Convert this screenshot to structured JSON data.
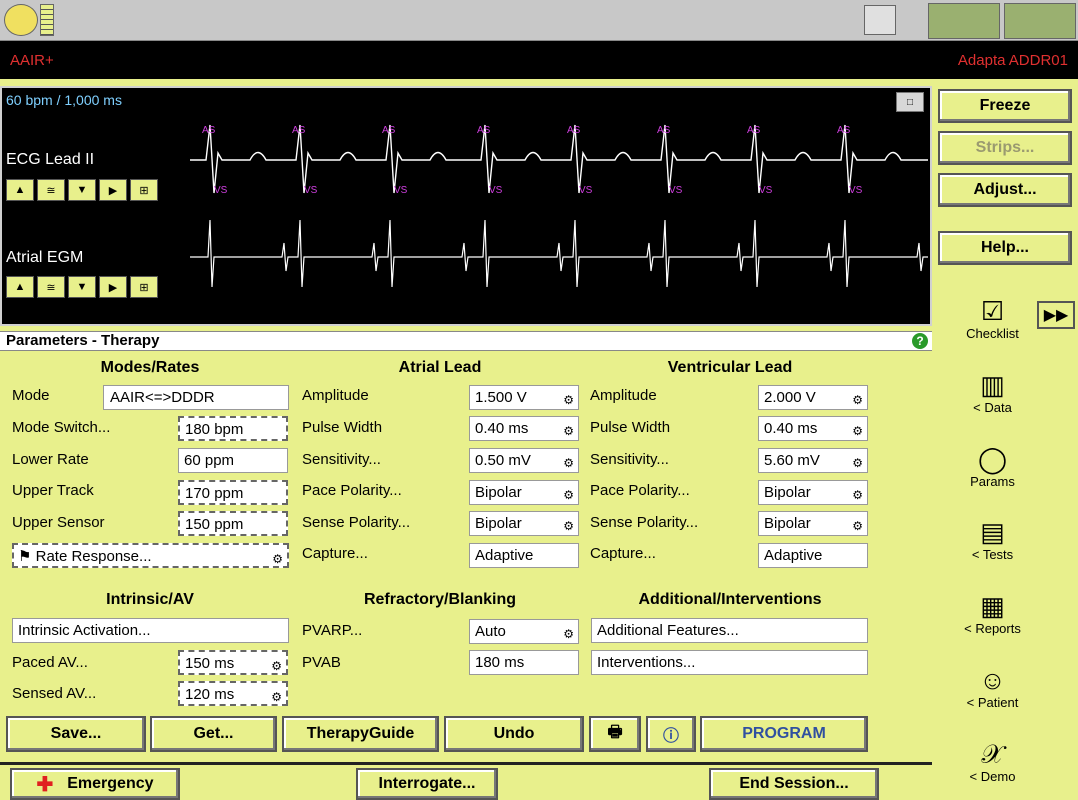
{
  "header": {
    "mode": "AAIR+",
    "device": "Adapta ADDR01"
  },
  "ecg": {
    "rate_readout": "60 bpm / 1,000 ms",
    "lead1": "ECG Lead II",
    "lead2": "Atrial EGM",
    "marker_top": "AS",
    "marker_bottom": "VS"
  },
  "side_buttons": {
    "freeze": "Freeze",
    "strips": "Strips...",
    "adjust": "Adjust...",
    "help": "Help..."
  },
  "params": {
    "header": "Parameters - Therapy",
    "modes_rates": {
      "title": "Modes/Rates",
      "rows": [
        {
          "label": "Mode",
          "value": "AAIR<=>DDDR"
        },
        {
          "label": "Mode Switch...",
          "value": "180 bpm"
        },
        {
          "label": "Lower Rate",
          "value": "60 ppm"
        },
        {
          "label": "Upper Track",
          "value": "170 ppm"
        },
        {
          "label": "Upper Sensor",
          "value": "150 ppm"
        }
      ],
      "rate_response": "Rate Response..."
    },
    "atrial": {
      "title": "Atrial Lead",
      "rows": [
        {
          "label": "Amplitude",
          "value": "1.500 V"
        },
        {
          "label": "Pulse Width",
          "value": "0.40 ms"
        },
        {
          "label": "Sensitivity...",
          "value": "0.50 mV"
        },
        {
          "label": "Pace Polarity...",
          "value": "Bipolar"
        },
        {
          "label": "Sense Polarity...",
          "value": "Bipolar"
        },
        {
          "label": "Capture...",
          "value": "Adaptive"
        }
      ]
    },
    "ventricular": {
      "title": "Ventricular Lead",
      "rows": [
        {
          "label": "Amplitude",
          "value": "2.000 V"
        },
        {
          "label": "Pulse Width",
          "value": "0.40 ms"
        },
        {
          "label": "Sensitivity...",
          "value": "5.60 mV"
        },
        {
          "label": "Pace Polarity...",
          "value": "Bipolar"
        },
        {
          "label": "Sense Polarity...",
          "value": "Bipolar"
        },
        {
          "label": "Capture...",
          "value": "Adaptive"
        }
      ]
    },
    "intrinsic": {
      "title": "Intrinsic/AV",
      "activation": "Intrinsic Activation...",
      "rows": [
        {
          "label": "Paced AV...",
          "value": "150 ms"
        },
        {
          "label": "Sensed AV...",
          "value": "120 ms"
        }
      ]
    },
    "refractory": {
      "title": "Refractory/Blanking",
      "rows": [
        {
          "label": "PVARP...",
          "value": "Auto"
        },
        {
          "label": "PVAB",
          "value": "180 ms"
        }
      ]
    },
    "additional": {
      "title": "Additional/Interventions",
      "features": "Additional Features...",
      "interventions": "Interventions..."
    }
  },
  "actions": {
    "save": "Save...",
    "get": "Get...",
    "therapy_guide": "TherapyGuide",
    "undo": "Undo",
    "program": "PROGRAM"
  },
  "footer": {
    "emergency": "Emergency",
    "interrogate": "Interrogate...",
    "end_session": "End Session..."
  },
  "nav": [
    "Checklist",
    "< Data",
    "Params",
    "< Tests",
    "< Reports",
    "< Patient",
    "< Demo"
  ]
}
